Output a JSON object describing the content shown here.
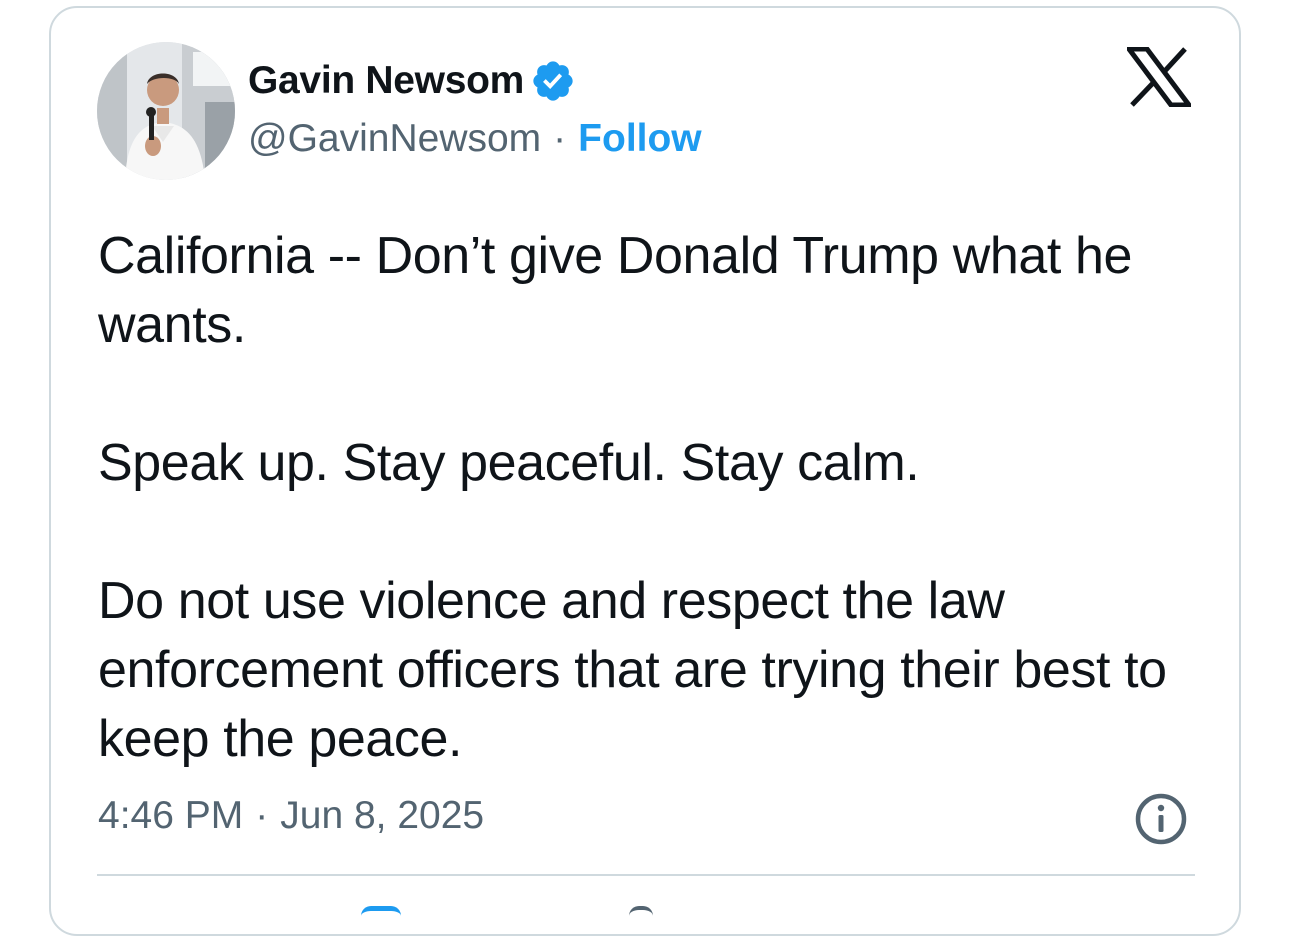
{
  "tweet": {
    "author": {
      "display_name": "Gavin Newsom",
      "handle": "@GavinNewsom",
      "separator": "·",
      "follow_label": "Follow",
      "verified": true,
      "avatar_icon": "profile-photo"
    },
    "brand_icon": "x-logo-icon",
    "paragraphs": [
      "California -- Don’t give Donald Trump what he wants.",
      "Speak up. Stay peaceful. Stay calm.",
      "Do not use violence and respect the law enforcement officers that are trying their best to keep the peace."
    ],
    "time": "4:46 PM",
    "time_separator": "·",
    "date": "Jun 8, 2025",
    "info_icon": "info-icon"
  },
  "colors": {
    "text": "#0f1419",
    "secondary": "#536471",
    "accent": "#1d9bf0",
    "border": "#cfd9de"
  }
}
